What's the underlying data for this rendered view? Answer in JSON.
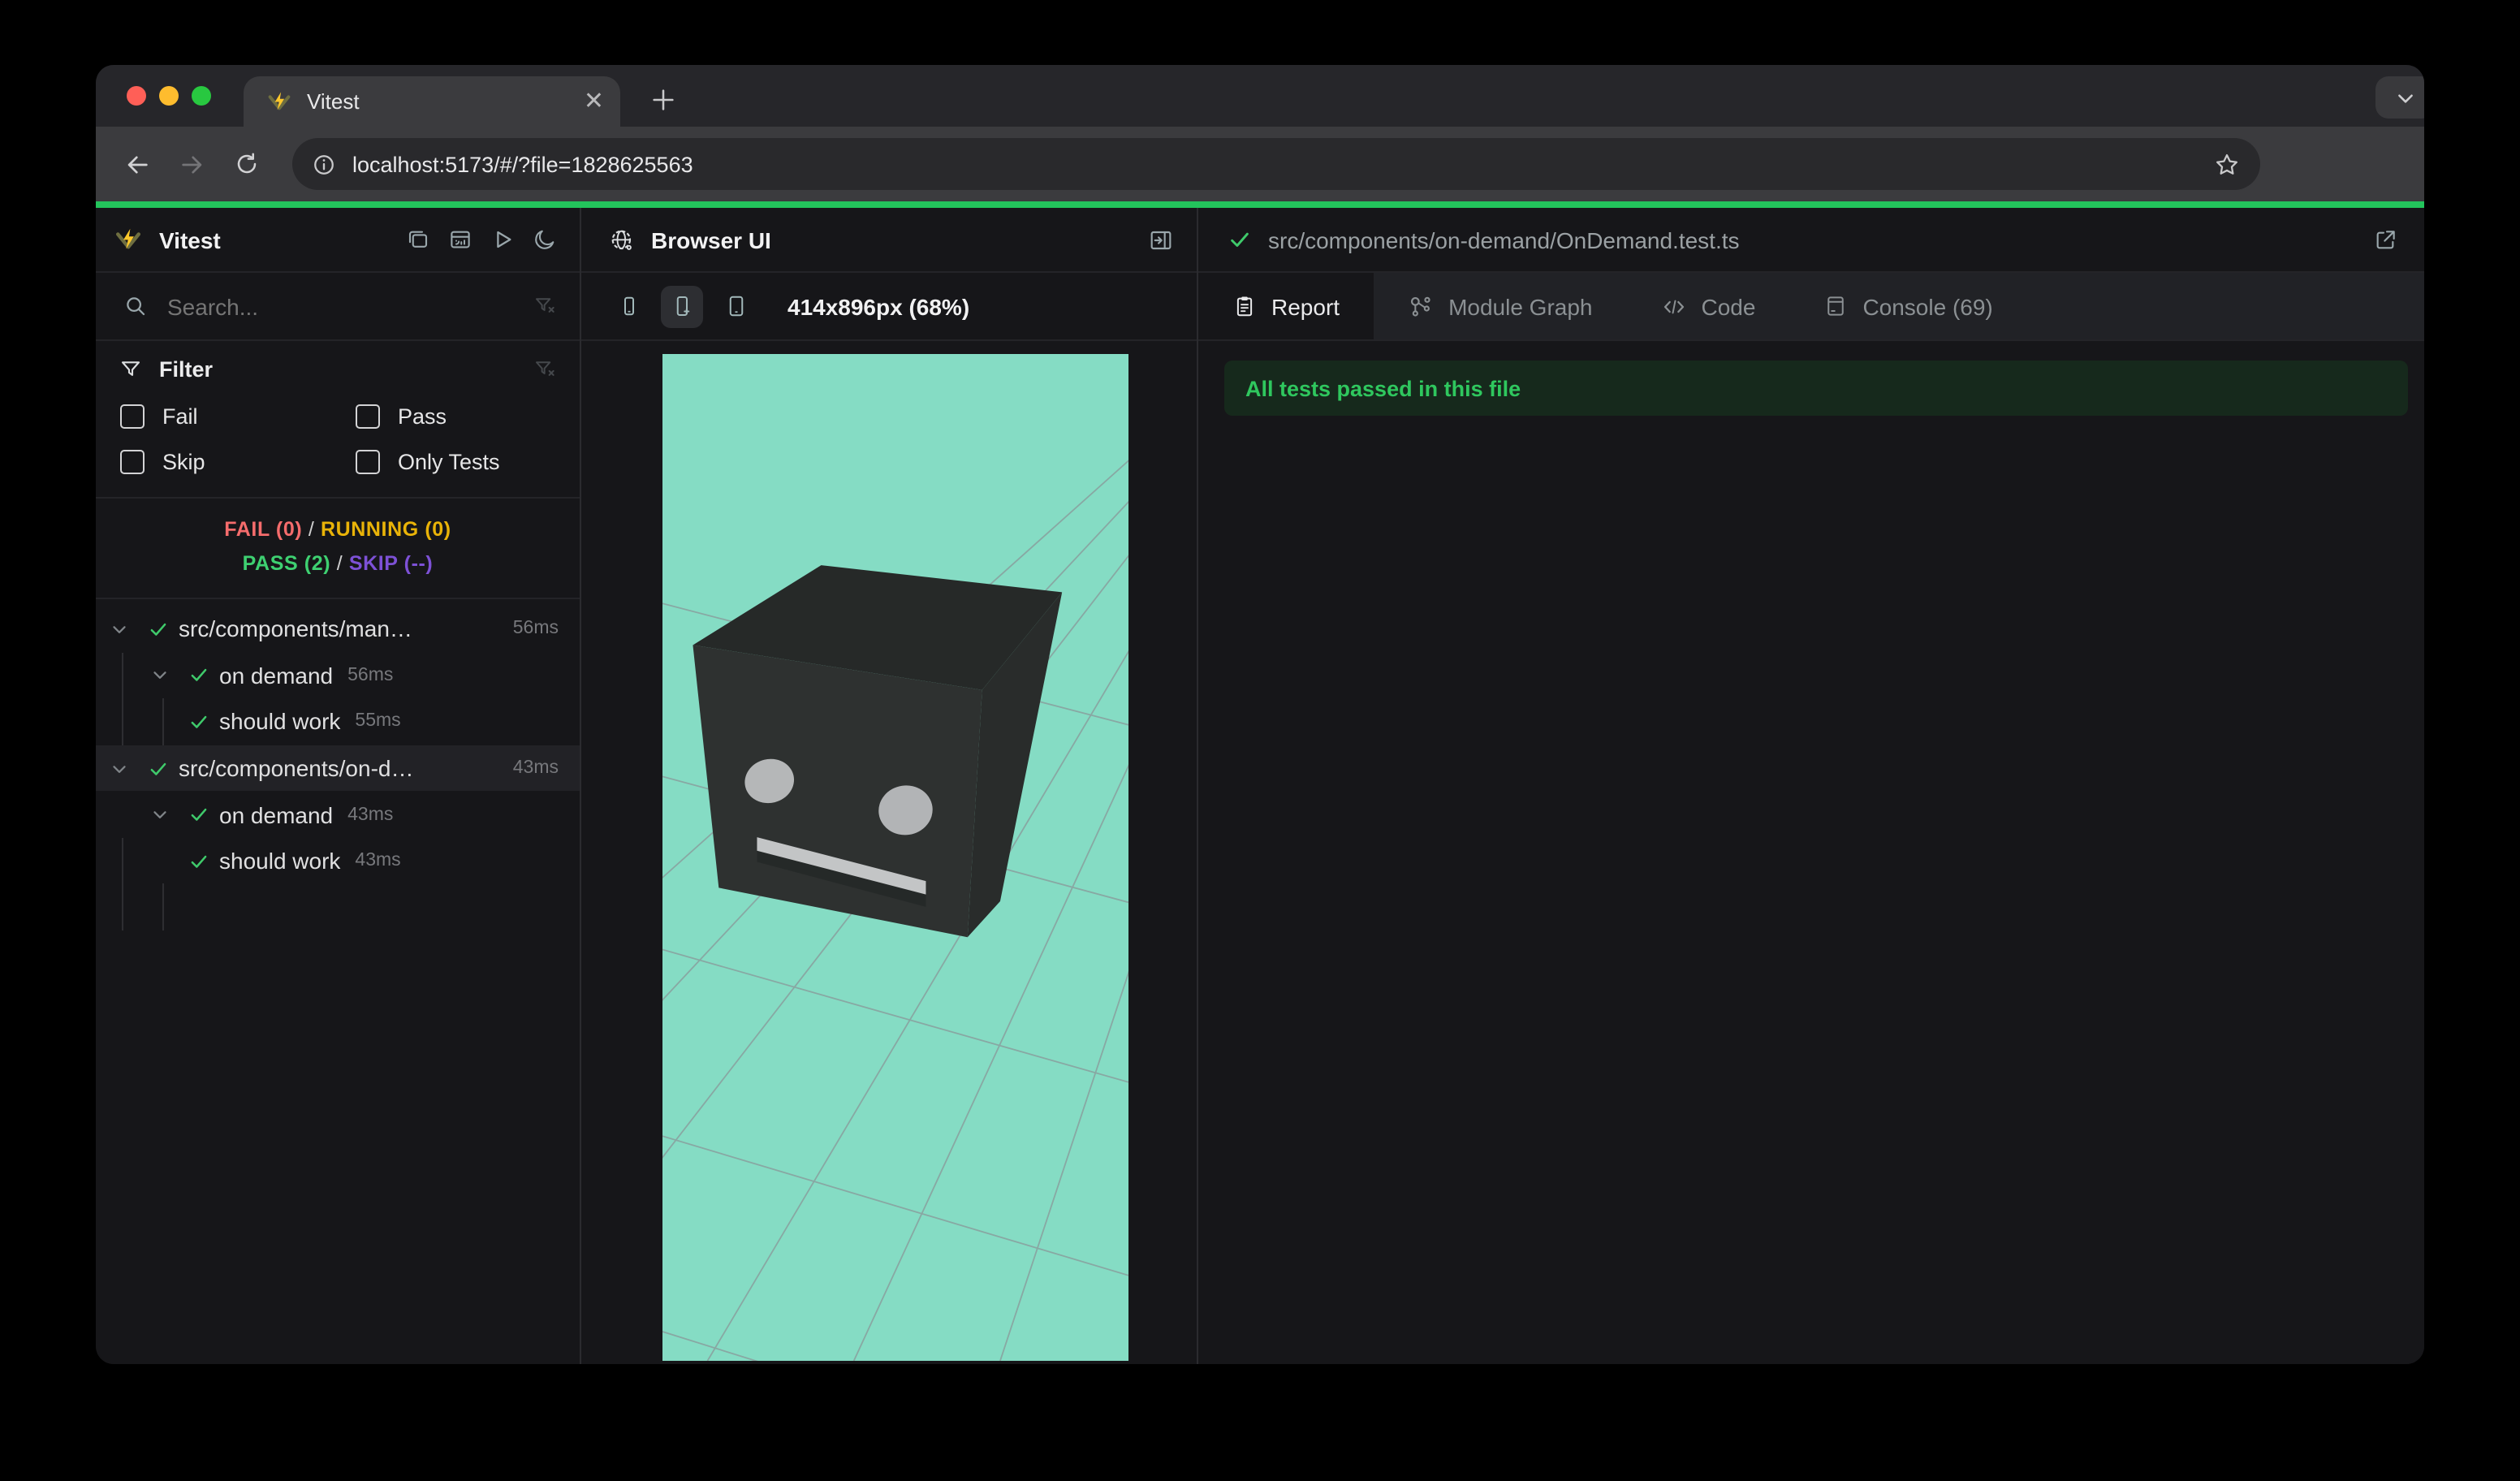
{
  "window": {
    "tab_title": "Vitest",
    "url": "localhost:5173/#/?file=1828625563"
  },
  "colors": {
    "progress_green": "#23c45c",
    "fail_red": "#f56c6c",
    "running_yellow": "#e9b308",
    "pass_green": "#3ed071",
    "skip_purple": "#7d51d6",
    "check_green": "#3fca6b",
    "banner_bg": "#16291c",
    "banner_text": "#2fc75e",
    "viewport_mint": "#85dcc4",
    "vitest_logo_yellow": "#fcc72b"
  },
  "sidebar": {
    "app_name": "Vitest",
    "search_placeholder": "Search...",
    "filter": {
      "title": "Filter",
      "options": [
        "Fail",
        "Pass",
        "Skip",
        "Only Tests"
      ]
    },
    "summary": {
      "fail": "FAIL (0)",
      "running": "RUNNING (0)",
      "pass": "PASS (2)",
      "skip": "SKIP (--)",
      "sep": "/"
    },
    "tree": [
      {
        "label": "src/components/manual/…",
        "duration": "56ms",
        "level": "file"
      },
      {
        "label": "on demand",
        "duration": "56ms",
        "level": "suite"
      },
      {
        "label": "should work",
        "duration": "55ms",
        "level": "test"
      },
      {
        "label": "src/components/on-dema…",
        "duration": "43ms",
        "level": "file"
      },
      {
        "label": "on demand",
        "duration": "43ms",
        "level": "suite"
      },
      {
        "label": "should work",
        "duration": "43ms",
        "level": "test"
      }
    ]
  },
  "preview": {
    "title": "Browser UI",
    "resolution": "414x896px (68%)"
  },
  "report": {
    "file_path": "src/components/on-demand/OnDemand.test.ts",
    "tabs": [
      {
        "label": "Report"
      },
      {
        "label": "Module Graph"
      },
      {
        "label": "Code"
      },
      {
        "label": "Console (69)"
      }
    ],
    "banner": "All tests passed in this file"
  }
}
